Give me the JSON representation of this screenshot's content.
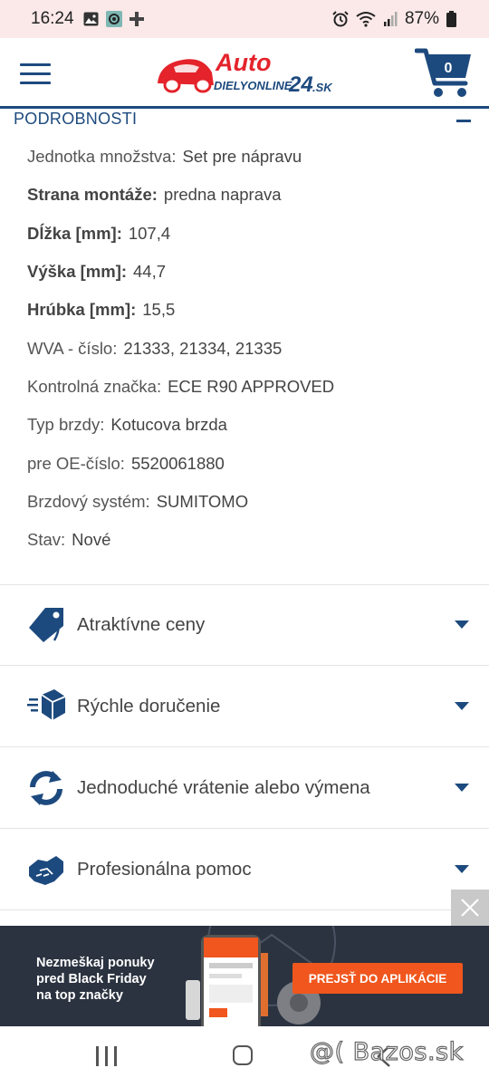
{
  "status_bar": {
    "time": "16:24",
    "battery": "87%",
    "left_icons": [
      "gallery-icon",
      "screen-record-icon",
      "plus-icon"
    ],
    "right_icons": [
      "alarm-icon",
      "wifi-icon",
      "signal-icon",
      "battery-icon"
    ]
  },
  "header": {
    "logo_line1": "Auto",
    "logo_line2": "DIELYONLINE",
    "logo_24": "24",
    "logo_sk": ".SK",
    "cart_count": "0"
  },
  "details": {
    "title": "PODROBNOSTI",
    "specs": [
      {
        "label": "Jednotka množstva:",
        "value": "Set pre nápravu",
        "bold": false
      },
      {
        "label": "Strana montáže:",
        "value": "predna naprava",
        "bold": true
      },
      {
        "label": "Dĺžka [mm]:",
        "value": "107,4",
        "bold": true
      },
      {
        "label": "Výška [mm]:",
        "value": "44,7",
        "bold": true
      },
      {
        "label": "Hrúbka [mm]:",
        "value": "15,5",
        "bold": true
      },
      {
        "label": "WVA - číslo:",
        "value": "21333, 21334, 21335",
        "bold": false
      },
      {
        "label": "Kontrolná značka:",
        "value": "ECE R90 APPROVED",
        "bold": false
      },
      {
        "label": "Typ brzdy:",
        "value": "Kotucova brzda",
        "bold": false
      },
      {
        "label": "pre OE-číslo:",
        "value": "5520061880",
        "bold": false
      },
      {
        "label": "Brzdový systém:",
        "value": "SUMITOMO",
        "bold": false
      },
      {
        "label": "Stav:",
        "value": "Nové",
        "bold": false
      }
    ]
  },
  "features": [
    {
      "label": "Atraktívne ceny",
      "icon": "price-tag-icon"
    },
    {
      "label": "Rýchle doručenie",
      "icon": "fast-delivery-icon"
    },
    {
      "label": "Jednoduché vrátenie alebo výmena",
      "icon": "exchange-arrows-icon"
    },
    {
      "label": "Profesionálna pomoc",
      "icon": "handshake-icon"
    }
  ],
  "ad": {
    "text_line1": "Nezmeškaj ponuky",
    "text_line2": "pred Black Friday",
    "text_line3": "na top značky",
    "cta": "PREJSŤ DO APLIKÁCIE"
  },
  "watermark": "@( Bazos.sk",
  "colors": {
    "brand_blue": "#1d4a7e",
    "logo_red": "#e4232b",
    "status_bar_bg": "#fae9e8",
    "ad_bg": "#2b3340",
    "cta_orange": "#f0561d"
  }
}
